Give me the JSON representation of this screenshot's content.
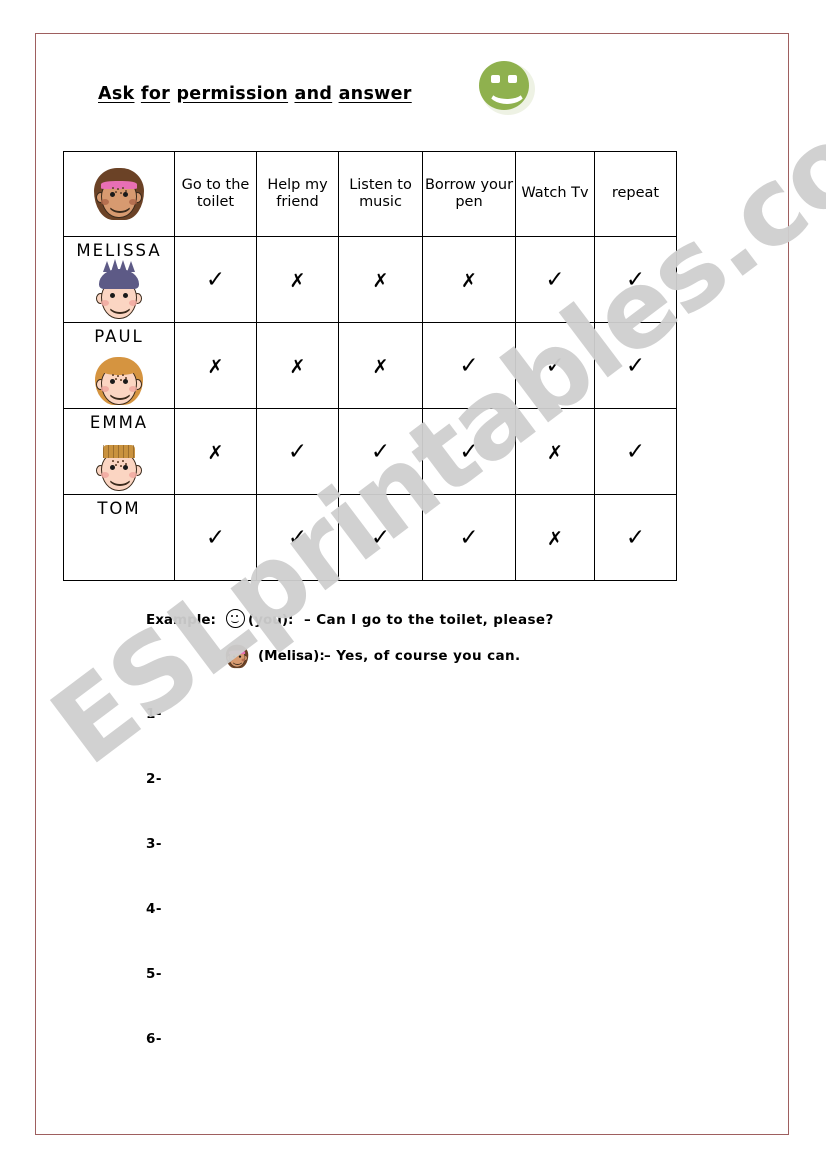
{
  "page": {
    "border_color": "#9e5f5f",
    "background": "#ffffff"
  },
  "header": {
    "title_words": [
      "Ask",
      "for",
      "permission",
      "and",
      "answer"
    ],
    "title_full": "Ask for permission and answer",
    "smiley_color": "#8fb14e",
    "smiley_name": "green-smiley-face"
  },
  "table": {
    "name_column_header_face": "melissa-face",
    "activity_headers": [
      "Go to\nthe toilet",
      "Help my\nfriend",
      "Listen\nto\nmusic",
      "Borrow\nyour pen",
      "Watch\nTv",
      "repeat"
    ],
    "activity_headers_flat": [
      "Go to the toilet",
      "Help my friend",
      "Listen to music",
      "Borrow your pen",
      "Watch Tv",
      "repeat"
    ],
    "tick": "✓",
    "cross": "✗",
    "rows": [
      {
        "name": "MELISSA",
        "face_below": "paul-face",
        "marks": [
          "tick",
          "cross",
          "cross",
          "cross",
          "tick",
          "tick"
        ]
      },
      {
        "name": "PAUL",
        "face_below": "emma-face",
        "marks": [
          "cross",
          "cross",
          "cross",
          "tick",
          "tick",
          "tick"
        ]
      },
      {
        "name": "EMMA",
        "face_below": "tom-face",
        "marks": [
          "cross",
          "tick",
          "tick",
          "tick",
          "cross",
          "tick"
        ]
      },
      {
        "name": "TOM",
        "face_below": "",
        "marks": [
          "tick",
          "tick",
          "tick",
          "tick",
          "cross",
          "tick"
        ]
      }
    ]
  },
  "example": {
    "label": "Example:",
    "speaker_one": "(you):",
    "line_one": "– Can I go to the toilet, please?",
    "speaker_two": "(Melisa):",
    "line_two": "– Yes, of course you can."
  },
  "answers": {
    "items": [
      "1-",
      "2-",
      "3-",
      "4-",
      "5-",
      "6-"
    ]
  },
  "watermark": {
    "text": "ESLprintables.com",
    "color": "#cfcfcf"
  }
}
